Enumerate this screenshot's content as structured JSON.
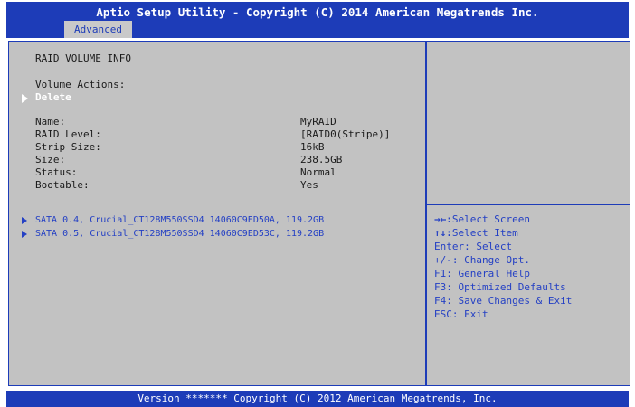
{
  "header": {
    "title": "Aptio Setup Utility - Copyright (C) 2014 American Megatrends Inc.",
    "tab_advanced": "Advanced"
  },
  "main": {
    "section_title": "RAID VOLUME INFO",
    "volume_actions_label": "Volume Actions:",
    "delete_label": "Delete",
    "fields": [
      {
        "label": "Name:",
        "value": "MyRAID"
      },
      {
        "label": "RAID Level:",
        "value": "[RAID0(Stripe)]"
      },
      {
        "label": "Strip Size:",
        "value": "16kB"
      },
      {
        "label": "Size:",
        "value": "238.5GB"
      },
      {
        "label": "Status:",
        "value": "Normal"
      },
      {
        "label": "Bootable:",
        "value": "Yes"
      }
    ],
    "disks": [
      "SATA 0.4, Crucial_CT128M550SSD4 14060C9ED50A, 119.2GB",
      "SATA 0.5, Crucial_CT128M550SSD4 14060C9ED53C, 119.2GB"
    ]
  },
  "help": {
    "items": [
      {
        "key": "→←:",
        "text": "Select Screen"
      },
      {
        "key": "↑↓:",
        "text": "Select Item"
      },
      {
        "key": "Enter:",
        "text": "Select"
      },
      {
        "key": "+/-:",
        "text": "Change Opt."
      },
      {
        "key": "F1:",
        "text": "General Help"
      },
      {
        "key": "F3:",
        "text": "Optimized Defaults"
      },
      {
        "key": "F4:",
        "text": "Save Changes & Exit"
      },
      {
        "key": "ESC:",
        "text": "Exit"
      }
    ]
  },
  "footer": {
    "text": "Version ******* Copyright (C) 2012 American Megatrends, Inc."
  },
  "colors": {
    "bios_blue": "#1d3cb8",
    "panel_grey": "#c2c2c2",
    "link_blue": "#2440c4"
  }
}
